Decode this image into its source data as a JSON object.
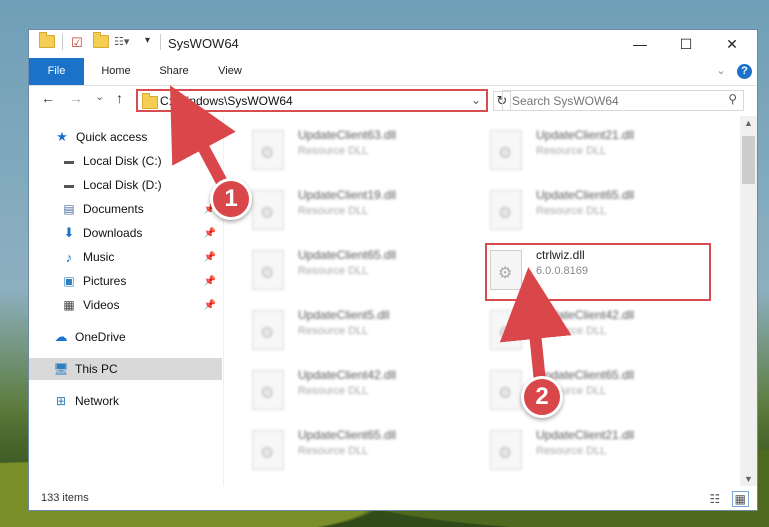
{
  "window": {
    "title": "SysWOW64",
    "minimize": "—",
    "maximize": "☐",
    "close": "✕"
  },
  "ribbon": {
    "tabs": [
      {
        "label": "File"
      },
      {
        "label": "Home"
      },
      {
        "label": "Share"
      },
      {
        "label": "View"
      }
    ],
    "expand": "⌄",
    "help": "?"
  },
  "address_bar": {
    "back": "←",
    "forward": "→",
    "recent": "⌄",
    "up": "↑",
    "path": "C:\\Windows\\SysWOW64",
    "dropdown": "⌄",
    "refresh": "↻"
  },
  "search": {
    "placeholder": "Search SysWOW64",
    "icon": "search-icon"
  },
  "nav": {
    "items": [
      {
        "label": "Quick access",
        "icon": "star-icon"
      },
      {
        "label": "Local Disk (C:)",
        "icon": "drive-icon"
      },
      {
        "label": "Local Disk (D:)",
        "icon": "drive-icon"
      },
      {
        "label": "Documents",
        "icon": "documents-icon"
      },
      {
        "label": "Downloads",
        "icon": "download-icon"
      },
      {
        "label": "Music",
        "icon": "music-icon"
      },
      {
        "label": "Pictures",
        "icon": "pictures-icon"
      },
      {
        "label": "Videos",
        "icon": "videos-icon"
      },
      {
        "label": "OneDrive",
        "icon": "cloud-icon"
      },
      {
        "label": "This PC",
        "icon": "computer-icon"
      },
      {
        "label": "Network",
        "icon": "network-icon"
      }
    ]
  },
  "files": [
    {
      "name": "UpdateClient63.dll",
      "type": "Resource DLL"
    },
    {
      "name": "UpdateClient21.dll",
      "type": "Resource DLL"
    },
    {
      "name": "UpdateClient19.dll",
      "type": "Resource DLL"
    },
    {
      "name": "UpdateClient65.dll",
      "type": "Resource DLL"
    },
    {
      "name": "UpdateClient65.dll",
      "type": "Resource DLL"
    },
    {
      "name": "ctrlwiz.dll",
      "type": "6.0.0.8169"
    },
    {
      "name": "UpdateClient5.dll",
      "type": "Resource DLL"
    },
    {
      "name": "UpdateClient42.dll",
      "type": "Resource DLL"
    },
    {
      "name": "UpdateClient42.dll",
      "type": "Resource DLL"
    },
    {
      "name": "UpdateClient65.dll",
      "type": "Resource DLL"
    },
    {
      "name": "UpdateClient65.dll",
      "type": "Resource DLL"
    },
    {
      "name": "UpdateClient21.dll",
      "type": "Resource DLL"
    }
  ],
  "status": {
    "count": "133 items"
  },
  "callouts": [
    {
      "number": "1"
    },
    {
      "number": "2"
    }
  ],
  "colors": {
    "accent": "#1a73c9",
    "highlight": "#d84b4f"
  }
}
